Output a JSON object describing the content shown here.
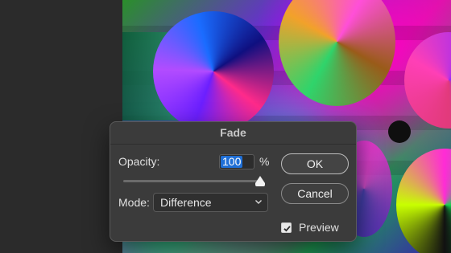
{
  "dialog": {
    "title": "Fade",
    "opacity_label": "Opacity:",
    "opacity_value": "100",
    "percent_label": "%",
    "opacity_slider_level": 1.0,
    "mode_label": "Mode:",
    "mode_value": "Difference",
    "ok_label": "OK",
    "cancel_label": "Cancel",
    "preview_label": "Preview",
    "preview_checked": true
  },
  "icons": {
    "dropdown": "chevron-down-icon",
    "checkbox": "checkmark-icon"
  },
  "colors": {
    "selection_highlight": "#1f6fd6",
    "dialog_background": "#3b3b3b"
  }
}
